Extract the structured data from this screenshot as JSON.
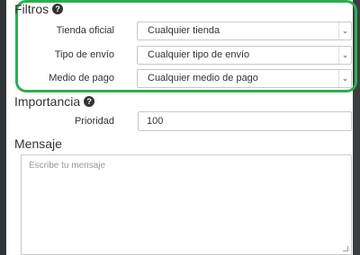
{
  "filters": {
    "title": "Filtros",
    "rows": [
      {
        "label": "Tienda oficial",
        "value": "Cualquier tienda"
      },
      {
        "label": "Tipo de envío",
        "value": "Cualquier tipo de envío"
      },
      {
        "label": "Medio de pago",
        "value": "Cualquier medio de pago"
      }
    ]
  },
  "importance": {
    "title": "Importancia",
    "priority_label": "Prioridad",
    "priority_value": "100"
  },
  "message": {
    "title": "Mensaje",
    "placeholder": "Escribe tu mensaje"
  },
  "colors": {
    "highlight": "#2eae4e",
    "backdrop": "#2f3336"
  },
  "icons": {
    "help": "question-circle-icon",
    "dropdown": "chevron-down-icon"
  }
}
